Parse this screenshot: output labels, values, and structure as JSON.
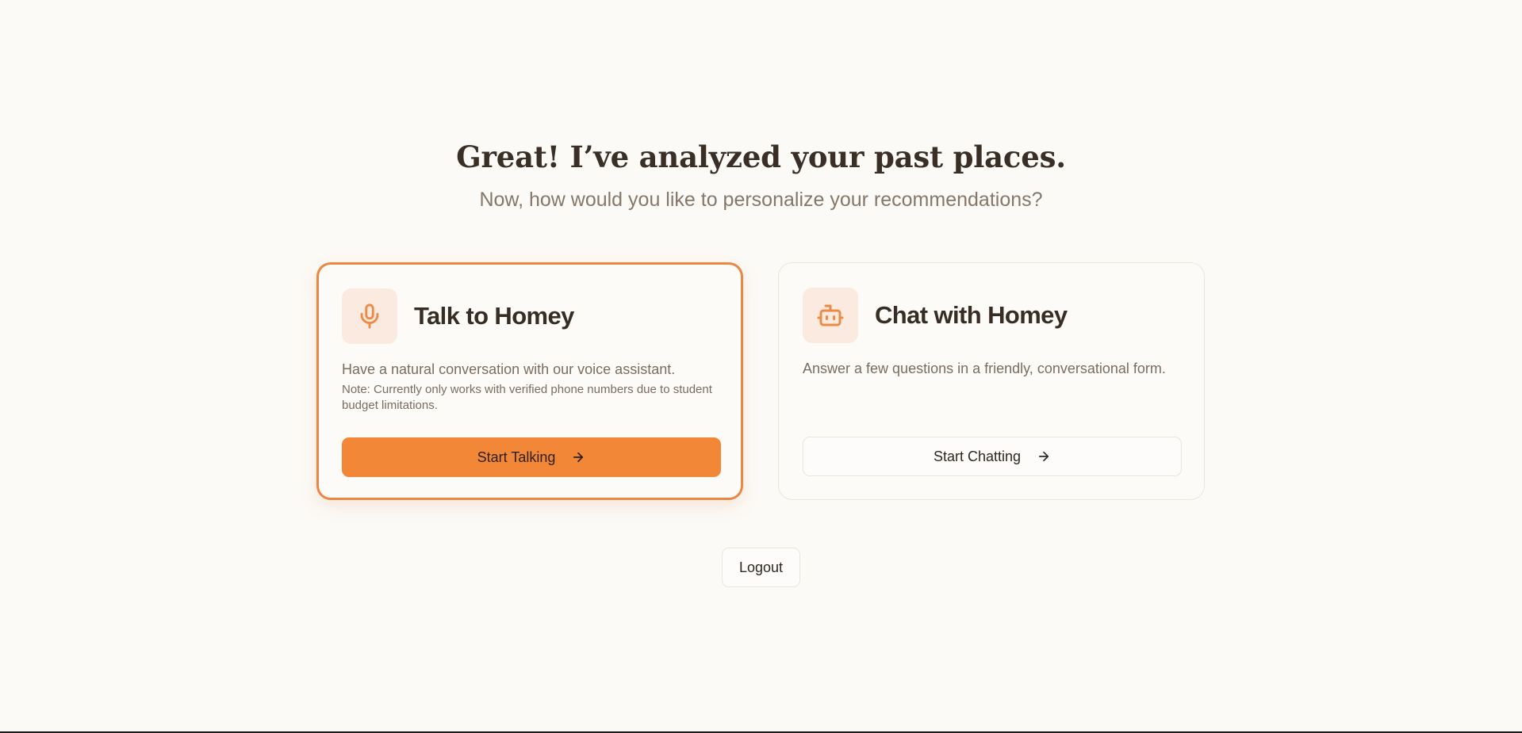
{
  "header": {
    "title": "Great! I’ve analyzed your past places.",
    "subtitle": "Now, how would you like to personalize your recommendations?"
  },
  "options": [
    {
      "title": "Talk to Homey",
      "description": "Have a natural conversation with our voice assistant.",
      "note": "Note: Currently only works with verified phone numbers due to student budget limitations.",
      "button_label": "Start Talking",
      "icon": "microphone-icon",
      "selected": true
    },
    {
      "title": "Chat with Homey",
      "description": "Answer a few questions in a friendly, conversational form.",
      "button_label": "Start Chatting",
      "icon": "robot-icon",
      "selected": false
    }
  ],
  "footer": {
    "logout_label": "Logout"
  },
  "colors": {
    "accent": "#f28738",
    "accent_border": "#eb8644",
    "icon_background": "#fbeadf",
    "page_background": "#fcfaf6"
  }
}
